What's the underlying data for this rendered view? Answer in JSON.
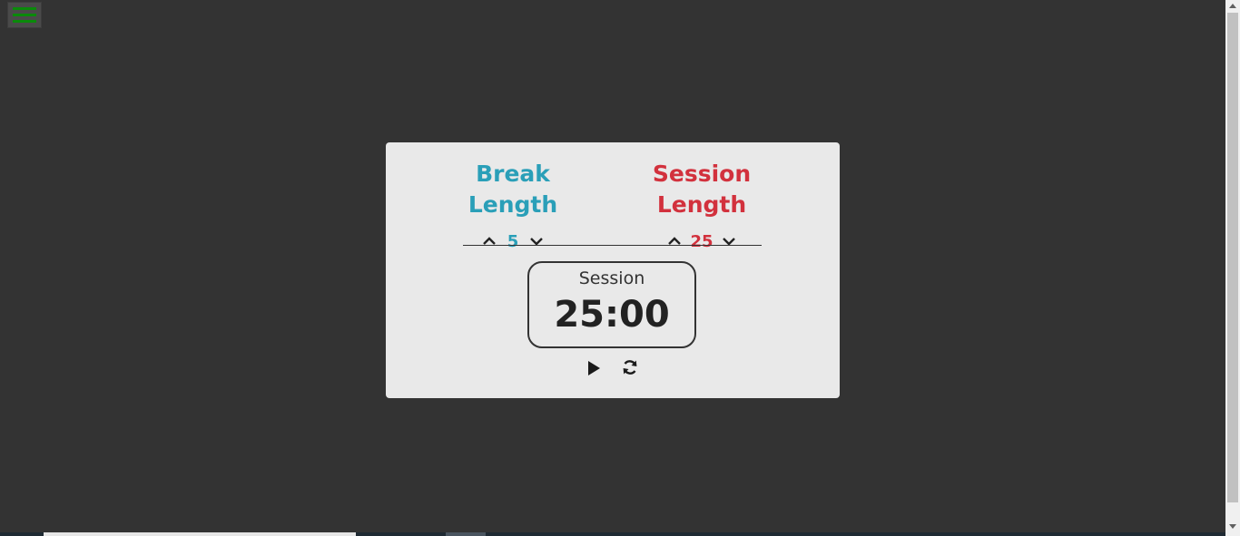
{
  "menu": {
    "icon": "hamburger-icon",
    "color": "#0a8a0a"
  },
  "break": {
    "title": "Break Length",
    "value": "5",
    "color": "#2a9fb8"
  },
  "session": {
    "title": "Session Length",
    "value": "25",
    "color": "#d2313d"
  },
  "timer": {
    "label": "Session",
    "value": "25:00"
  },
  "controls": {
    "play_icon": "play-icon",
    "reset_icon": "refresh-icon"
  }
}
